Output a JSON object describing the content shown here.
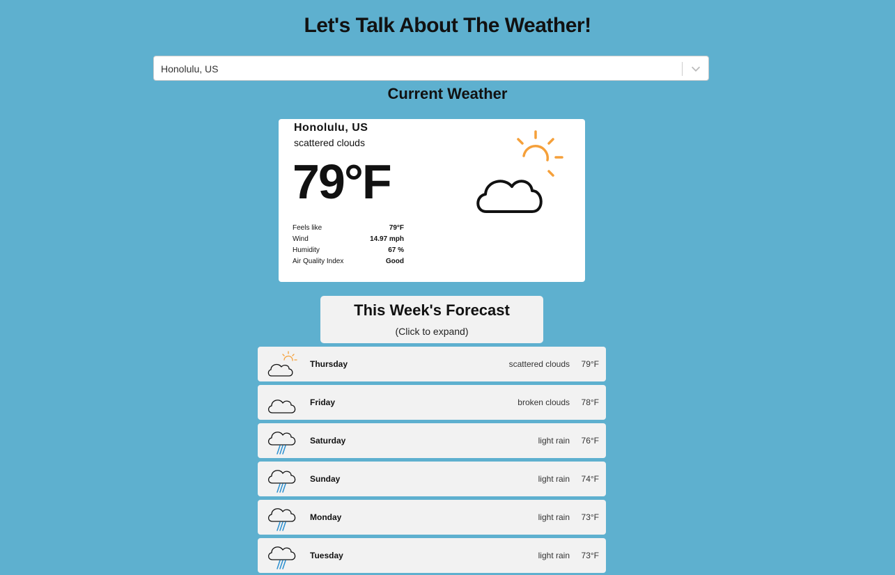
{
  "header": {
    "title": "Let's Talk About The Weather!"
  },
  "search": {
    "value": "Honolulu, US"
  },
  "current": {
    "section_title": "Current Weather",
    "city": "Honolulu, US",
    "description": "scattered clouds",
    "temperature": "79°F",
    "icon": "partly-cloudy-icon",
    "details": [
      {
        "label": "Feels like",
        "value": "79°F"
      },
      {
        "label": "Wind",
        "value": "14.97 mph"
      },
      {
        "label": "Humidity",
        "value": "67 %"
      },
      {
        "label": "Air Quality Index",
        "value": "Good"
      }
    ]
  },
  "forecast": {
    "title": "This Week's Forecast",
    "subtitle": "(Click to expand)",
    "days": [
      {
        "day": "Thursday",
        "description": "scattered clouds",
        "temp": "79°F",
        "icon": "partly-cloudy-icon"
      },
      {
        "day": "Friday",
        "description": "broken clouds",
        "temp": "78°F",
        "icon": "cloud-icon"
      },
      {
        "day": "Saturday",
        "description": "light rain",
        "temp": "76°F",
        "icon": "rain-icon"
      },
      {
        "day": "Sunday",
        "description": "light rain",
        "temp": "74°F",
        "icon": "rain-icon"
      },
      {
        "day": "Monday",
        "description": "light rain",
        "temp": "73°F",
        "icon": "rain-icon"
      },
      {
        "day": "Tuesday",
        "description": "light rain",
        "temp": "73°F",
        "icon": "rain-icon"
      }
    ]
  },
  "colors": {
    "background": "#5eb0cf",
    "sun": "#f5a03a",
    "rain": "#2a8fd0",
    "card": "#f2f2f2"
  }
}
